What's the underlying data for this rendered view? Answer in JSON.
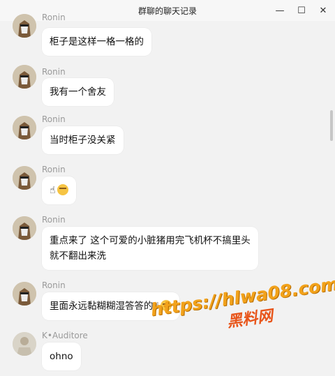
{
  "window": {
    "title": "群聊的聊天记录",
    "controls": [
      "minimize",
      "maximize",
      "close"
    ]
  },
  "messages": [
    {
      "sender": "Ronin",
      "text": "柜子是这样一格一格的",
      "avatar": "ronin"
    },
    {
      "sender": "Ronin",
      "text": "我有一个舍友",
      "avatar": "ronin"
    },
    {
      "sender": "Ronin",
      "text": "当时柜子没关紧",
      "avatar": "ronin"
    },
    {
      "sender": "Ronin",
      "text": "",
      "emoji": [
        "index-up-hand",
        "nerd-face"
      ],
      "avatar": "ronin"
    },
    {
      "sender": "Ronin",
      "text_lines": [
        "重点来了 这个可爱的小脏猪用完飞机杯不搞里头",
        "就不翻出来洗"
      ],
      "avatar": "ronin"
    },
    {
      "sender": "Ronin",
      "text": "里面永远黏糊糊湿答答的",
      "emoji": [
        "index-up-hand",
        "nerd-face"
      ],
      "avatar": "ronin"
    },
    {
      "sender": "K•Auditore",
      "text": "ohno",
      "avatar": "k-auditore"
    }
  ],
  "watermark": {
    "url": "https://hlwa08.com",
    "brand": "黑料网"
  },
  "colors": {
    "background": "#f2f2f2",
    "bubble": "#ffffff",
    "name": "#9a9a9a",
    "watermark_url": "#f2a21b",
    "watermark_brand": "#e8551a"
  }
}
